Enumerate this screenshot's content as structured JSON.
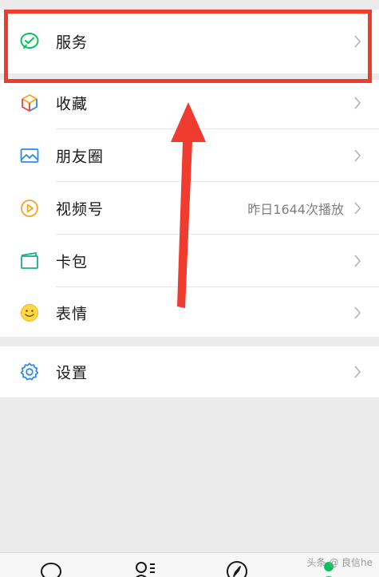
{
  "menu": {
    "services": {
      "label": "服务",
      "icon": "wechat-pay-check-icon"
    },
    "favorites": {
      "label": "收藏",
      "icon": "cube-icon"
    },
    "moments": {
      "label": "朋友圈",
      "icon": "picture-icon"
    },
    "channels": {
      "label": "视频号",
      "icon": "play-circle-icon",
      "value": "昨日1644次播放"
    },
    "card_wallet": {
      "label": "卡包",
      "icon": "wallet-icon"
    },
    "stickers": {
      "label": "表情",
      "icon": "smiley-icon"
    },
    "settings": {
      "label": "设置",
      "icon": "gear-icon"
    }
  },
  "tabbar": {
    "items": [
      {
        "icon": "chat-bubble-icon"
      },
      {
        "icon": "contacts-icon"
      },
      {
        "icon": "compass-icon"
      },
      {
        "icon": "me-person-icon",
        "active": true
      }
    ]
  },
  "watermark": "头条 @ 良信he",
  "colors": {
    "highlight": "#f03c2e",
    "arrow": "#f03c2e",
    "wechat_green": "#07c160",
    "chevron": "#b2b2b2"
  }
}
